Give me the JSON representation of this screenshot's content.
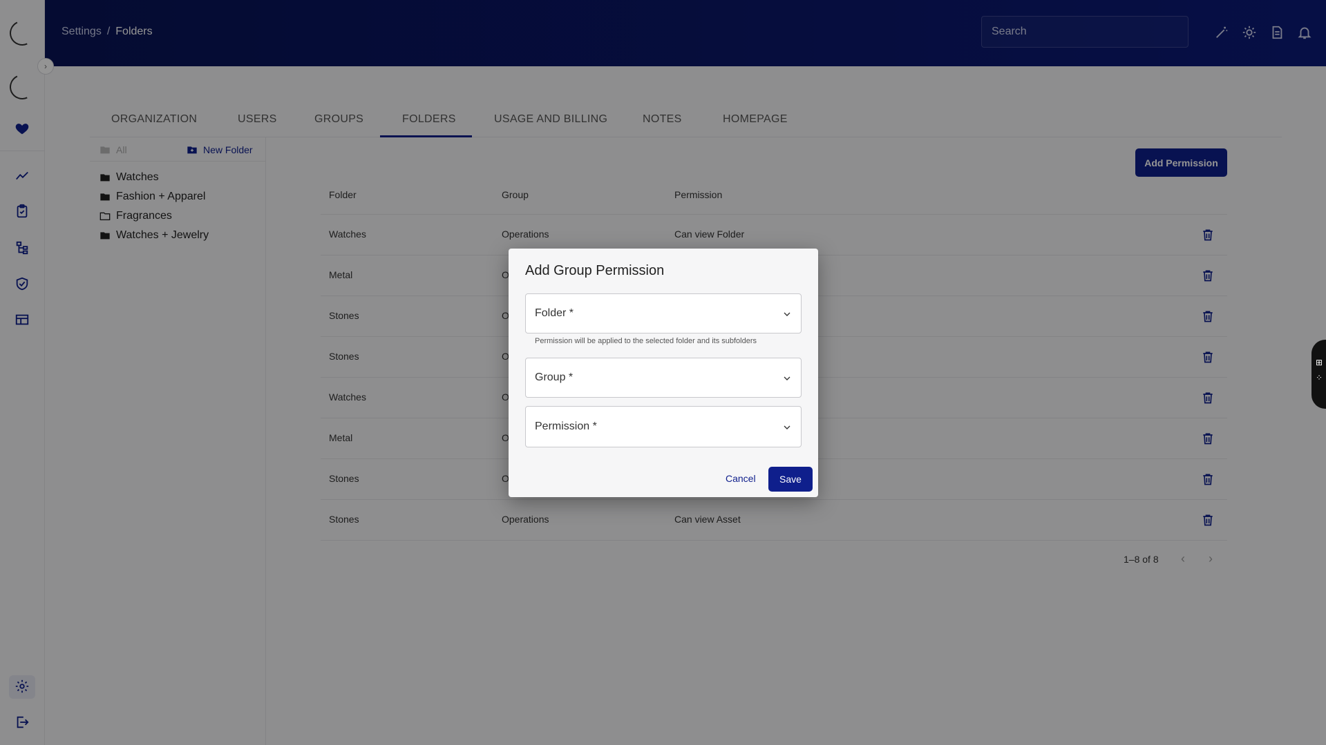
{
  "header": {
    "breadcrumb_parent": "Settings",
    "breadcrumb_sep": "/",
    "breadcrumb_current": "Folders",
    "search_placeholder": "Search"
  },
  "sidebar": {
    "items": [
      "logo-spinner",
      "loading-spinner",
      "heart-icon",
      "analytics-icon",
      "clipboard-check-icon",
      "hierarchy-icon",
      "shield-check-icon",
      "table-icon",
      "gear-icon",
      "logout-icon"
    ]
  },
  "tabs": [
    "ORGANIZATION",
    "USERS",
    "GROUPS",
    "FOLDERS",
    "USAGE AND BILLING",
    "NOTES",
    "HOMEPAGE"
  ],
  "active_tab": "FOLDERS",
  "folder_panel": {
    "all_label": "All",
    "new_folder_label": "New Folder",
    "folders": [
      "Watches",
      "Fashion + Apparel",
      "Fragrances",
      "Watches + Jewelry"
    ]
  },
  "main": {
    "add_permission_label": "Add Permission",
    "columns": [
      "Folder",
      "Group",
      "Permission"
    ],
    "rows": [
      {
        "folder": "Watches",
        "group": "Operations",
        "permission": "Can view Folder"
      },
      {
        "folder": "Metal",
        "group": "O",
        "permission": ""
      },
      {
        "folder": "Stones",
        "group": "O",
        "permission": ""
      },
      {
        "folder": "Stones",
        "group": "O",
        "permission": ""
      },
      {
        "folder": "Watches",
        "group": "O",
        "permission": ""
      },
      {
        "folder": "Metal",
        "group": "O",
        "permission": ""
      },
      {
        "folder": "Stones",
        "group": "O",
        "permission": ""
      },
      {
        "folder": "Stones",
        "group": "Operations",
        "permission": "Can view Asset"
      }
    ],
    "pagination": "1–8 of 8"
  },
  "dialog": {
    "title": "Add Group Permission",
    "folder_label": "Folder *",
    "folder_helper": "Permission will be applied to the selected folder and its subfolders",
    "group_label": "Group *",
    "permission_label": "Permission *",
    "cancel_label": "Cancel",
    "save_label": "Save"
  },
  "colors": {
    "primary": "#0f1f8c",
    "header_bg": "#0a1456",
    "overlay": "rgba(0,0,0,0.42)"
  }
}
